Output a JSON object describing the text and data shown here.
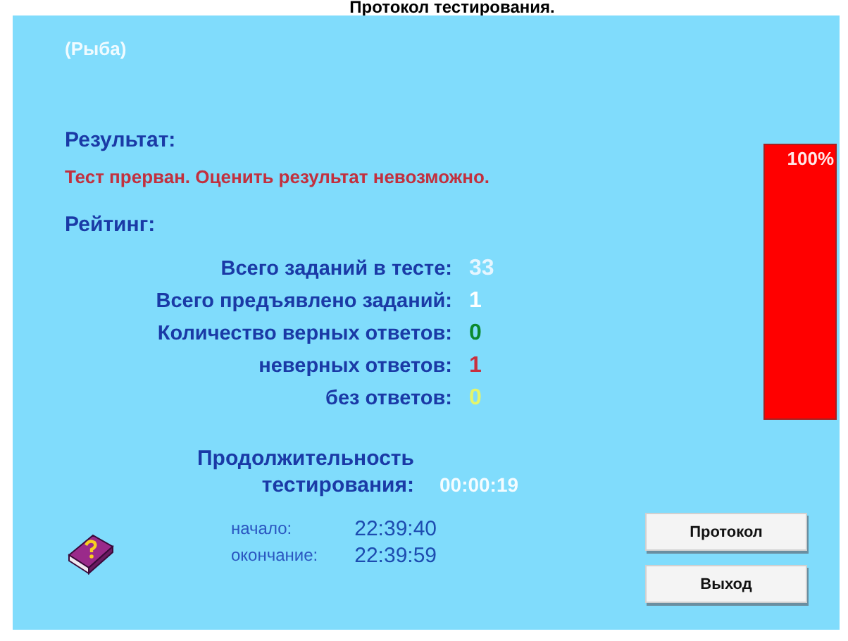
{
  "title": "Протокол тестирования.",
  "subject": "(Рыба)",
  "result": {
    "label": "Результат:",
    "message": "Тест прерван. Оценить результат невозможно."
  },
  "meter": {
    "level": 1,
    "reading": "100%"
  },
  "rating": {
    "label": "Рейтинг:",
    "rows": [
      {
        "label": "Всего заданий в тесте:",
        "value": "33",
        "color": "#e6f6ff"
      },
      {
        "label": "Всего предъявлено заданий:",
        "value": "1",
        "color": "#ffffff"
      },
      {
        "label": "Количество верных ответов:",
        "value": "0",
        "color": "#0b8a2e"
      },
      {
        "label": "неверных ответов:",
        "value": "1",
        "color": "#c8303e"
      },
      {
        "label": "без ответов:",
        "value": "0",
        "color": "#e4f56a"
      }
    ]
  },
  "duration": {
    "label_line_1": "Продолжительность",
    "label_line_2": "тестирования:",
    "value": "00:00:19"
  },
  "times": [
    {
      "label": "начало:",
      "value": "22:39:40"
    },
    {
      "label": "окончание:",
      "value": "22:39:59"
    }
  ],
  "buttons": [
    "Протокол",
    "Выход"
  ]
}
